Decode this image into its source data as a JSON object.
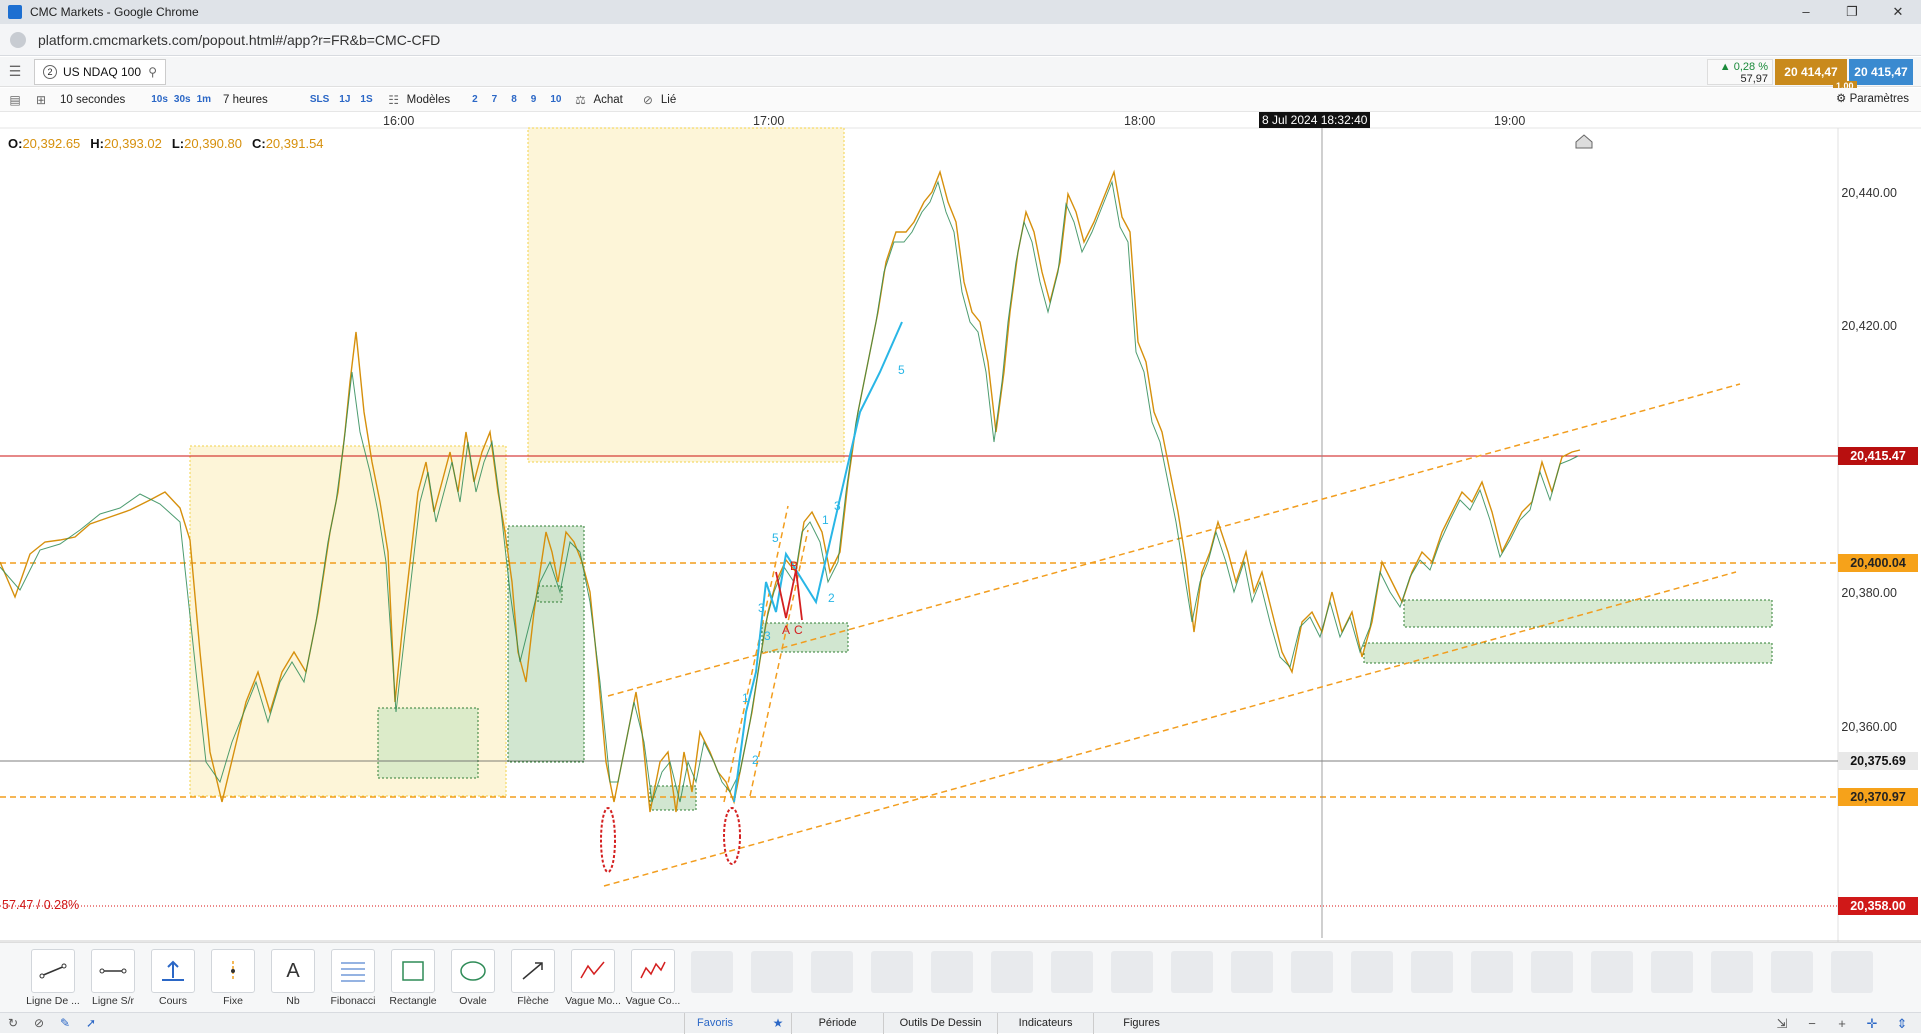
{
  "browser": {
    "window_title": "CMC Markets - Google Chrome",
    "url": "platform.cmcmarkets.com/popout.html#/app?r=FR&b=CMC-CFD"
  },
  "toolbar": {
    "instrument_badge": "2",
    "instrument": "US NDAQ 100",
    "interval": "10 secondes",
    "interval_buttons": [
      "10s",
      "30s",
      "1m"
    ],
    "range": "7 heures",
    "range_buttons": [
      "SLS",
      "1J",
      "1S"
    ],
    "templates_label": "Modèles",
    "number_buttons": [
      "2",
      "7",
      "8",
      "9",
      "10"
    ],
    "buy_label": "Achat",
    "link_label": "Lié",
    "settings_label": "Paramètres"
  },
  "quote": {
    "change_pct": "▲ 0,28 %",
    "change_pts": "57,97",
    "sell": "20 414,47",
    "buy": "20 415,47",
    "spread": "1,00",
    "sell_color": "#c98a1c",
    "buy_color": "#3a8ad0"
  },
  "chart": {
    "time_labels": [
      "16:00",
      "17:00",
      "18:00",
      "19:00"
    ],
    "crosshair_time": "8 Jul 2024 18:32:40",
    "ohlc": {
      "o_label": "O:",
      "o": "20,392.65",
      "h_label": "H:",
      "h": "20,393.02",
      "l_label": "L:",
      "l": "20,390.80",
      "c_label": "C:",
      "c": "20,391.54"
    },
    "price_ticks": [
      "20,440.00",
      "20,420.00",
      "20,380.00",
      "20,360.00"
    ],
    "price_tags": {
      "current": "20,415.47",
      "level_1": "20,400.04",
      "crosshair": "20,375.69",
      "level_2": "20,370.97",
      "level_3": "20,358.00"
    },
    "change_label": "57.47 / 0.28%",
    "wave_labels_blue": [
      "1",
      "2",
      "3",
      "5",
      "3",
      "1",
      "2",
      "3",
      "5"
    ],
    "wave_labels_red": [
      "B",
      "A",
      "C"
    ],
    "colors": {
      "candles": "#d6900d",
      "candles_alt": "#2e8b57",
      "level_line": "#f29d1e",
      "current_price": "#cc1111",
      "wave": "#29b6e6"
    }
  },
  "drawing_tools": [
    {
      "label": "Ligne De ...",
      "icon": "line-icon"
    },
    {
      "label": "Ligne S/r",
      "icon": "sr-line-icon"
    },
    {
      "label": "Cours",
      "icon": "price-icon"
    },
    {
      "label": "Fixe",
      "icon": "fixed-icon"
    },
    {
      "label": "Nb",
      "icon": "text-icon"
    },
    {
      "label": "Fibonacci",
      "icon": "fibonacci-icon"
    },
    {
      "label": "Rectangle",
      "icon": "rectangle-icon"
    },
    {
      "label": "Ovale",
      "icon": "oval-icon"
    },
    {
      "label": "Flèche",
      "icon": "arrow-icon"
    },
    {
      "label": "Vague Mo...",
      "icon": "wave-mo-icon"
    },
    {
      "label": "Vague Co...",
      "icon": "wave-co-icon"
    }
  ],
  "bottom_tabs": {
    "favoris": "Favoris",
    "periode": "Période",
    "outils": "Outils De Dessin",
    "indicateurs": "Indicateurs",
    "figures": "Figures"
  }
}
